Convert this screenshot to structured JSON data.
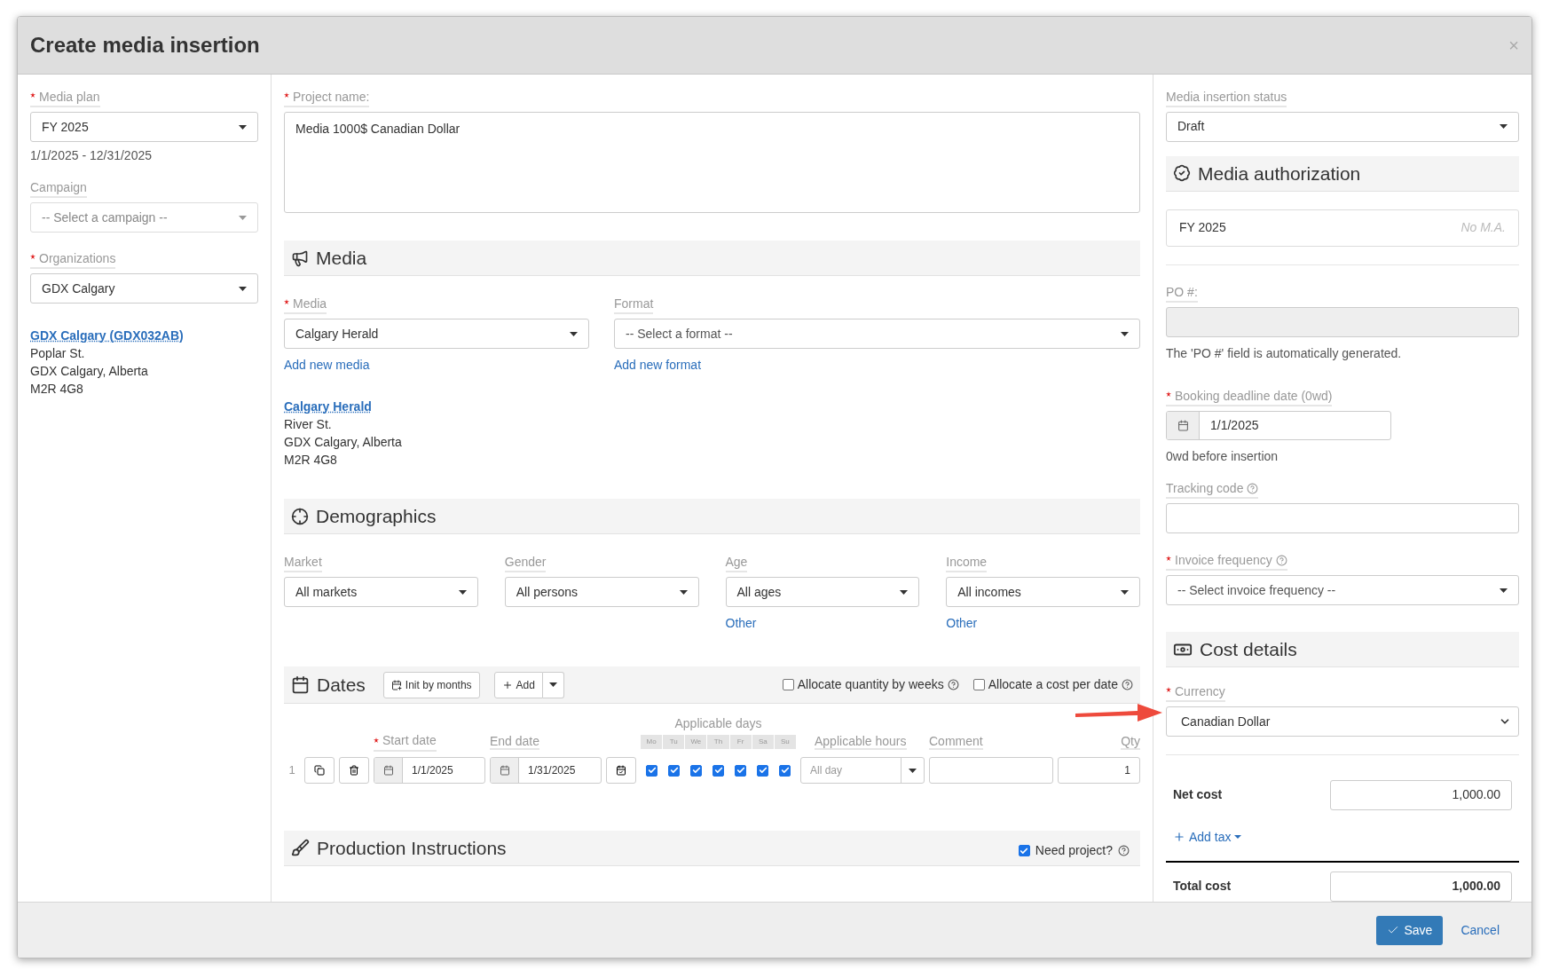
{
  "dialog": {
    "title": "Create media insertion",
    "close": "×"
  },
  "left": {
    "media_plan": {
      "label": "Media plan",
      "required": true,
      "value": "FY 2025"
    },
    "date_range": "1/1/2025 - 12/31/2025",
    "campaign": {
      "label": "Campaign",
      "required": false,
      "placeholder": "-- Select a campaign --"
    },
    "organizations": {
      "label": "Organizations",
      "required": true,
      "value": "GDX Calgary"
    },
    "organization_address": {
      "link": "GDX Calgary (GDX032AB)",
      "lines": [
        "Poplar St.",
        "GDX Calgary, Alberta",
        "M2R 4G8"
      ]
    }
  },
  "middle": {
    "project_name": {
      "label": "Project name:",
      "required": true,
      "value": "Media 1000$ Canadian Dollar"
    },
    "media_section": {
      "title": "Media",
      "media": {
        "label": "Media",
        "required": true,
        "value": "Calgary Herald",
        "link": "Add new media"
      },
      "format": {
        "label": "Format",
        "required": false,
        "placeholder": "-- Select a format --",
        "link": "Add new format"
      },
      "address": {
        "link": "Calgary Herald",
        "lines": [
          "River St.",
          "GDX Calgary, Alberta",
          "M2R 4G8"
        ]
      }
    },
    "demographics": {
      "title": "Demographics",
      "fields": [
        {
          "label": "Market",
          "value": "All markets"
        },
        {
          "label": "Gender",
          "value": "All persons"
        },
        {
          "label": "Age",
          "value": "All ages",
          "link": "Other"
        },
        {
          "label": "Income",
          "value": "All incomes",
          "link": "Other"
        }
      ]
    },
    "dates": {
      "title": "Dates",
      "init_button": "Init by months",
      "add_button": "Add",
      "options": [
        {
          "label": "Allocate quantity by weeks",
          "checked": false
        },
        {
          "label": "Allocate a cost per date",
          "checked": false
        }
      ],
      "columns": {
        "start": "Start date",
        "start_required": true,
        "end": "End date",
        "days": "Applicable days",
        "hours": "Applicable hours",
        "comment": "Comment",
        "qty": "Qty"
      },
      "rows": [
        {
          "index": "1",
          "start": "1/1/2025",
          "end": "1/31/2025",
          "hours_placeholder": "All day",
          "qty": "1",
          "days": [
            {
              "label": "Mo",
              "checked": true
            },
            {
              "label": "Tu",
              "checked": true
            },
            {
              "label": "We",
              "checked": true
            },
            {
              "label": "Th",
              "checked": true
            },
            {
              "label": "Fr",
              "checked": true
            },
            {
              "label": "Sa",
              "checked": true
            },
            {
              "label": "Su",
              "checked": true
            }
          ]
        }
      ]
    },
    "production": {
      "title": "Production Instructions",
      "need_project": {
        "label": "Need project?",
        "checked": true
      }
    }
  },
  "right": {
    "status": {
      "label": "Media insertion status",
      "value": "Draft"
    },
    "authorization": {
      "title": "Media authorization",
      "plan": "FY 2025",
      "note": "No M.A."
    },
    "po": {
      "label": "PO #:",
      "help": "The 'PO #' field is automatically generated."
    },
    "booking": {
      "label": "Booking deadline date (0wd)",
      "required": true,
      "value": "1/1/2025",
      "note": "0wd before insertion"
    },
    "tracking": {
      "label": "Tracking code"
    },
    "invoice": {
      "label": "Invoice frequency",
      "required": true,
      "placeholder": "-- Select invoice frequency --"
    },
    "cost": {
      "title": "Cost details",
      "currency": {
        "label": "Currency",
        "required": true,
        "value": "Canadian Dollar"
      },
      "net_cost": {
        "label": "Net cost",
        "value": "1,000.00"
      },
      "add_tax": "Add tax",
      "total_cost": {
        "label": "Total cost",
        "value": "1,000.00"
      }
    }
  },
  "footer": {
    "save": "Save",
    "cancel": "Cancel"
  }
}
